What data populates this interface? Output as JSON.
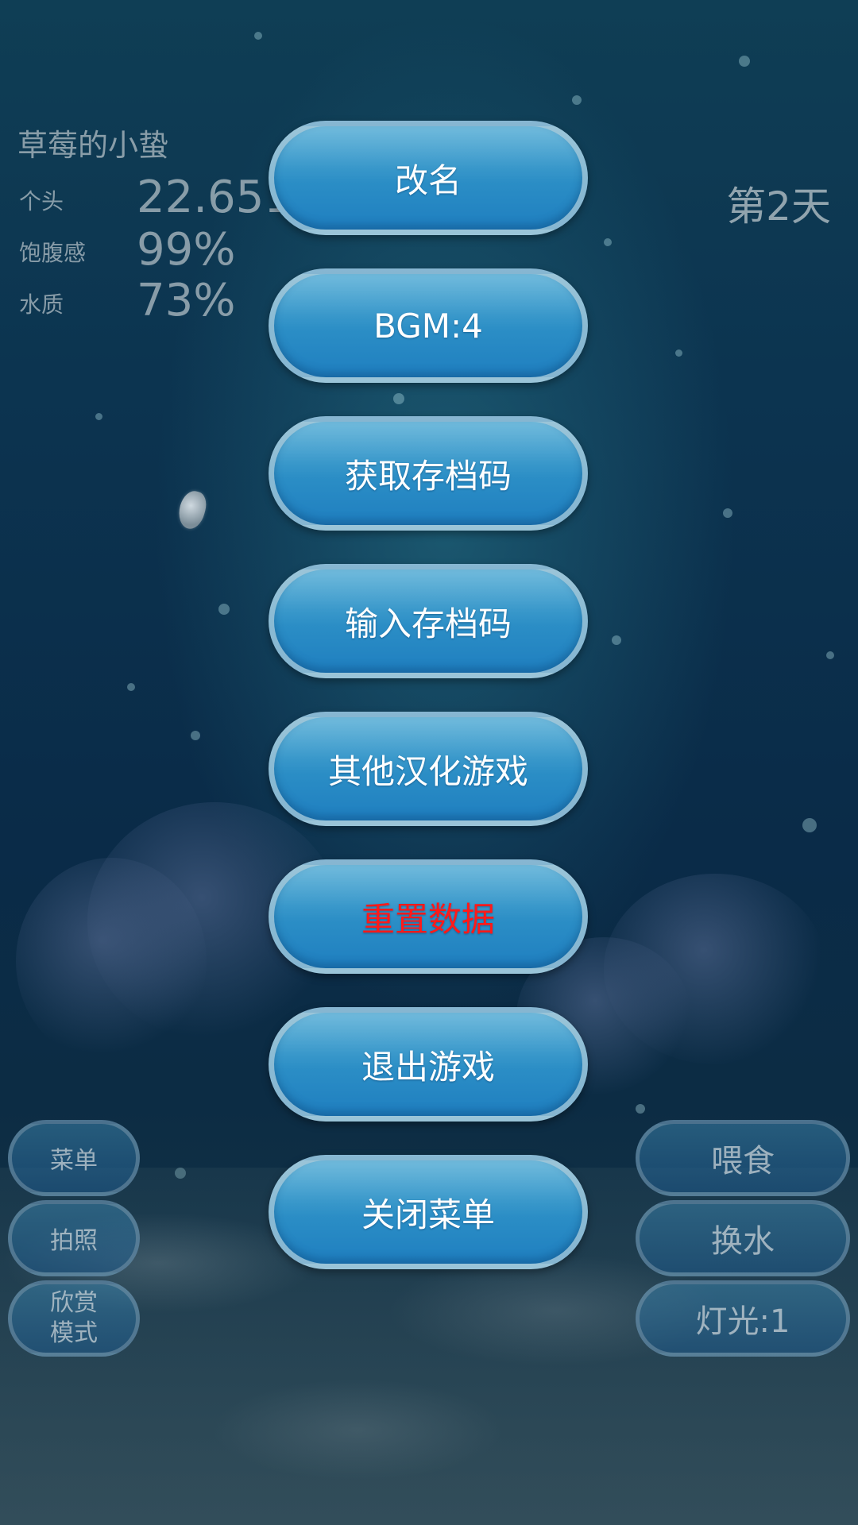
{
  "stats": {
    "pet_name": "草莓的小蛰",
    "size_label": "个头",
    "size_value": "22.651108mm",
    "fullness_label": "饱腹感",
    "fullness_value": "99%",
    "water_label": "水质",
    "water_value": "73%",
    "day_counter": "第2天"
  },
  "menu": {
    "items": [
      {
        "label": "改名"
      },
      {
        "label": "BGM:4"
      },
      {
        "label": "获取存档码"
      },
      {
        "label": "输入存档码"
      },
      {
        "label": "其他汉化游戏"
      },
      {
        "label": "重置数据"
      },
      {
        "label": "退出游戏"
      },
      {
        "label": "关闭菜单"
      }
    ],
    "danger_color": "#ff1a1a"
  },
  "left_buttons": {
    "menu_label": "菜单",
    "photo_label": "拍照",
    "view_mode_line1": "欣赏",
    "view_mode_line2": "模式"
  },
  "right_buttons": {
    "feed_label": "喂食",
    "water_change_label": "换水",
    "light_label": "灯光:1"
  }
}
